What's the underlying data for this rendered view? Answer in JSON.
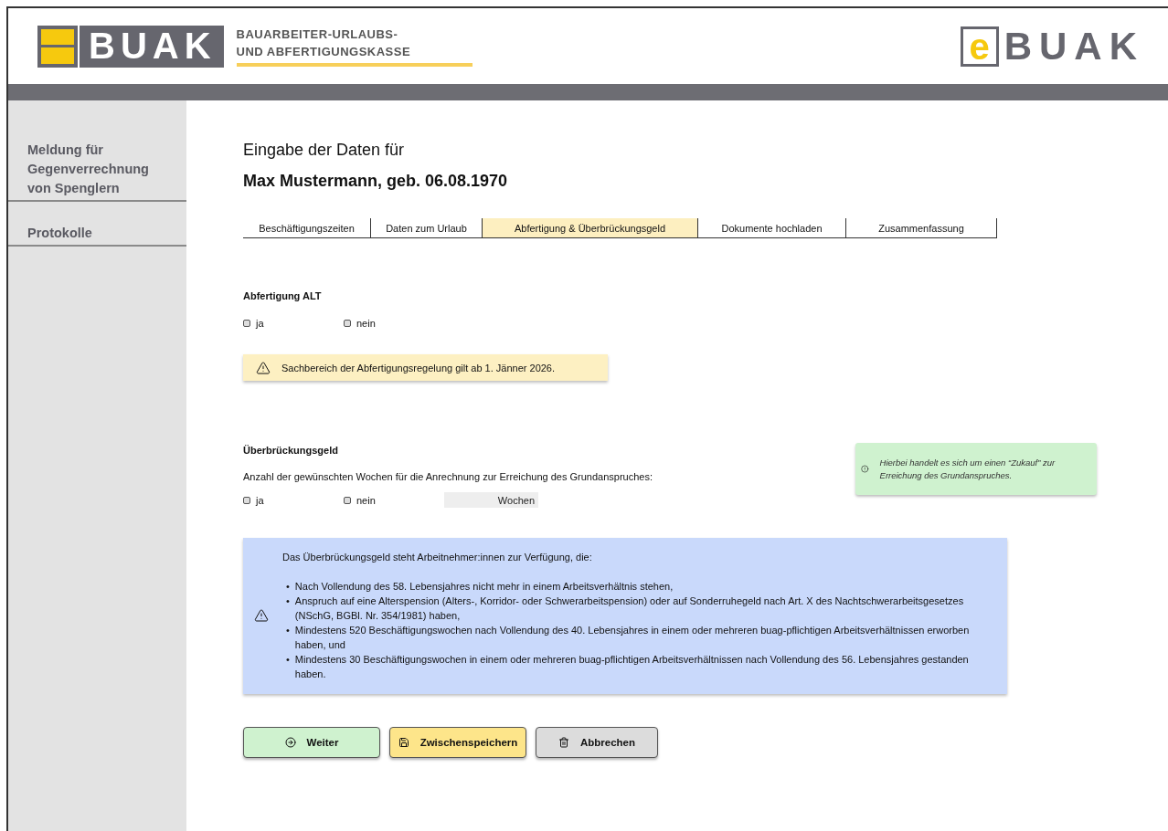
{
  "header": {
    "logo": {
      "mark": "BUAK",
      "line1": "BAUARBEITER-URLAUBS-",
      "line2": "UND ABFERTIGUNGSKASSE"
    },
    "elogo": {
      "prefix": "e",
      "name": "BUAK"
    }
  },
  "sidebar": {
    "items": [
      {
        "label": "Meldung für Gegenverrechnung von Spenglern",
        "selected": false
      },
      {
        "label": "Protokolle",
        "selected": false
      }
    ]
  },
  "page": {
    "title": "Eingabe der Daten für",
    "person": "Max Mustermann, geb. 06.08.1970"
  },
  "tabs": [
    {
      "label": "Beschäftigungszeiten",
      "selected": false
    },
    {
      "label": "Daten zum Urlaub",
      "selected": false
    },
    {
      "label": "Abfertigung & Überbrückungsgeld",
      "selected": true
    },
    {
      "label": "Dokumente hochladen",
      "selected": false
    },
    {
      "label": "Zusammenfassung",
      "selected": false
    }
  ],
  "abfertigung": {
    "heading": "Abfertigung ALT",
    "options": [
      {
        "label": "ja",
        "checked": false
      },
      {
        "label": "nein",
        "checked": false
      }
    ],
    "warning": "Sachbereich der Abfertigungsregelung gilt ab 1. Jänner 2026."
  },
  "ueberbrueckung": {
    "heading": "Überbrückungsgeld",
    "question": "Anzahl der gewünschten Wochen für die Anrechnung  zur Erreichung des Grundanspruches:",
    "options": [
      {
        "label": "ja",
        "checked": false
      },
      {
        "label": "nein",
        "checked": false
      }
    ],
    "weeks_field": {
      "placeholder": "Wochen"
    },
    "hint": "Hierbei handelt es sich um einen “Zukauf” zur Erreichung des Grundanspruches."
  },
  "info": {
    "intro": "Das Überbrückungsgeld steht Arbeitnehmer:innen zur Verfügung, die:",
    "items": [
      {
        "bullet": "•",
        "text": "Nach Vollendung des 58. Lebensjahres nicht mehr in einem Arbeitsverhältnis stehen,"
      },
      {
        "bullet": "•",
        "text": "Anspruch auf eine Alterspension (Alters-, Korridor- oder Schwerarbeitspension) oder auf Sonderruhegeld nach Art. X des Nachtschwerarbeitsgesetzes (NSchG, BGBl. Nr. 354/1981) haben,"
      },
      {
        "bullet": "•",
        "text": "Mindestens 520 Beschäftigungswochen nach Vollendung des 40. Lebensjahres in einem oder mehreren buag-pflichtigen Arbeitsverhältnissen erworben haben, und"
      },
      {
        "bullet": "•",
        "text": "Mindestens 30 Beschäftigungswochen in einem oder mehreren buag-pflichtigen Arbeitsverhältnissen nach Vollendung des 56. Lebensjahres gestanden haben."
      }
    ]
  },
  "buttons": [
    {
      "label": "Weiter",
      "kind": "next"
    },
    {
      "label": "Zwischenspeichern",
      "kind": "save"
    },
    {
      "label": "Abbrechen",
      "kind": "cancel"
    }
  ]
}
